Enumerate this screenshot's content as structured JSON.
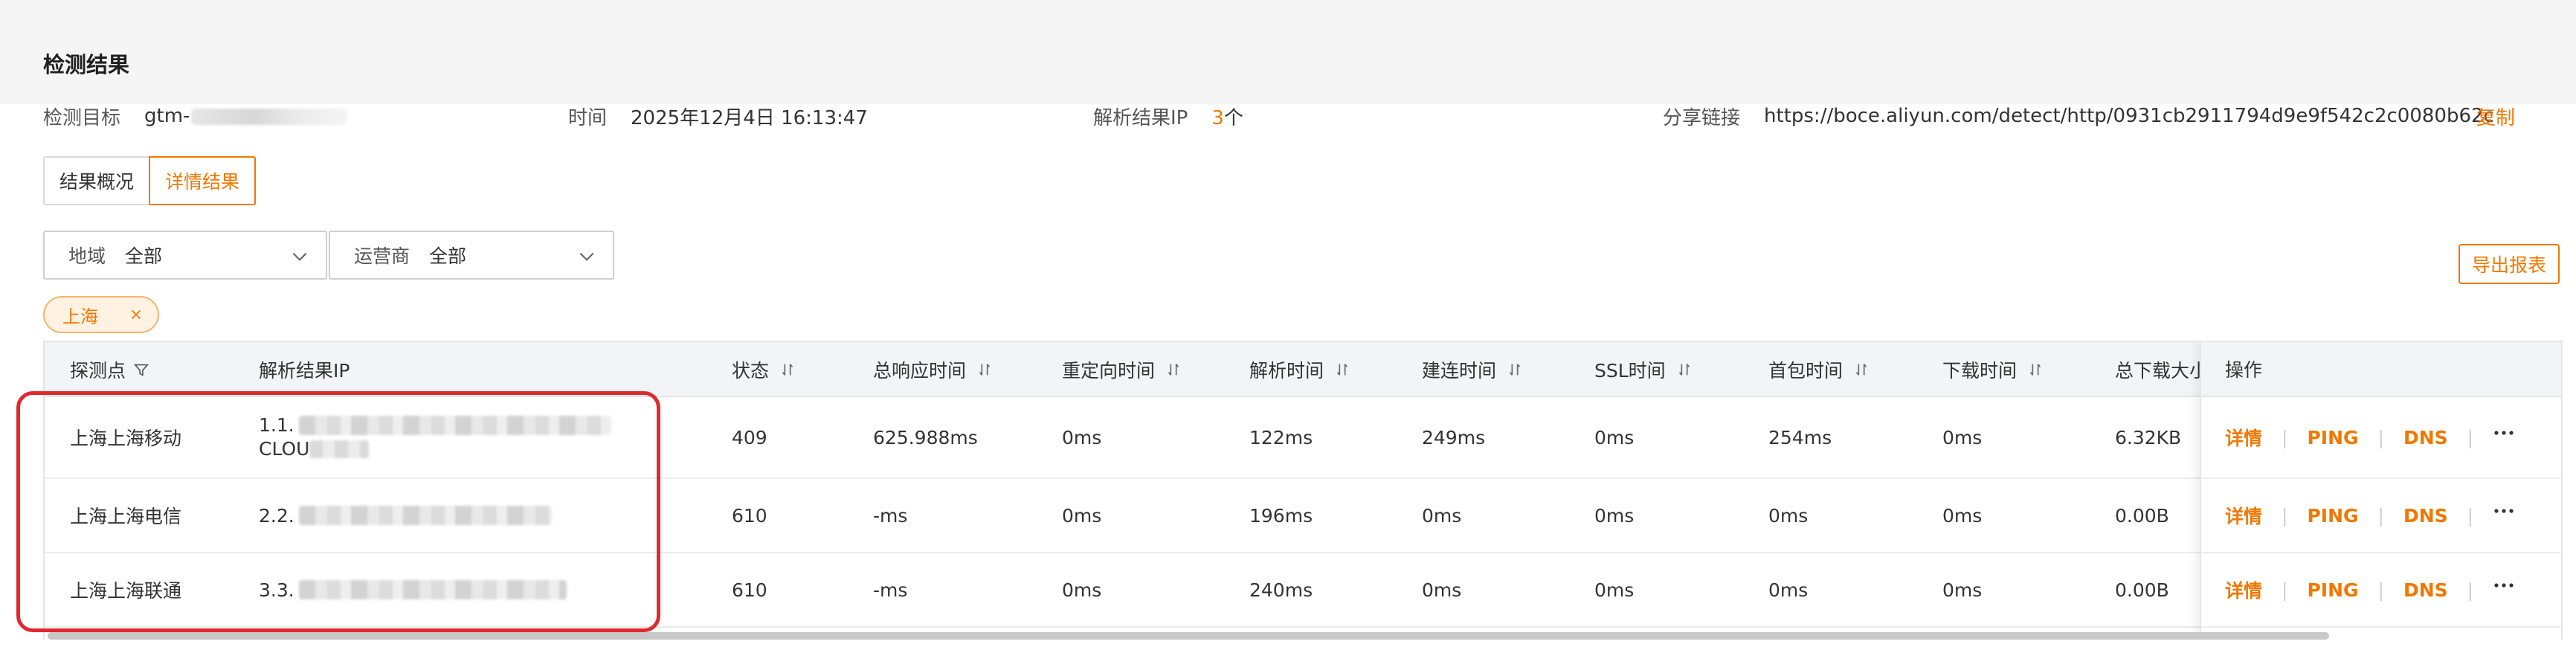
{
  "page_title": "检测结果",
  "info": {
    "target_label": "检测目标",
    "target_value": "gtm-",
    "time_label": "时间",
    "time_value": "2025年12月4日 16:13:47",
    "resolved_label": "解析结果IP",
    "resolved_count": "3",
    "resolved_unit": "个",
    "share_label": "分享链接",
    "share_value": "https://boce.aliyun.com/detect/http/0931cb2911794d9e9f542c2c0080b62c",
    "copy_label": "复制"
  },
  "tabs": [
    {
      "label": "结果概况",
      "active": false
    },
    {
      "label": "详情结果",
      "active": true
    }
  ],
  "filters": {
    "region_label": "地域",
    "region_value": "全部",
    "isp_label": "运营商",
    "isp_value": "全部"
  },
  "export_label": "导出报表",
  "active_tag": "上海",
  "table": {
    "headers": [
      "探测点",
      "解析结果IP",
      "状态",
      "总响应时间",
      "重定向时间",
      "解析时间",
      "建连时间",
      "SSL时间",
      "首包时间",
      "下载时间",
      "总下载大小",
      "操作"
    ],
    "rows": [
      {
        "probe": "上海上海移动",
        "ip": "1.1.",
        "ip_extra": "CLOU",
        "status": "409",
        "total": "625.988ms",
        "redirect": "0ms",
        "dns": "122ms",
        "connect": "249ms",
        "ssl": "0ms",
        "first_byte": "254ms",
        "download": "0ms",
        "size": "6.32KB"
      },
      {
        "probe": "上海上海电信",
        "ip": "2.2.",
        "ip_extra": "",
        "status": "610",
        "total": "-ms",
        "redirect": "0ms",
        "dns": "196ms",
        "connect": "0ms",
        "ssl": "0ms",
        "first_byte": "0ms",
        "download": "0ms",
        "size": "0.00B"
      },
      {
        "probe": "上海上海联通",
        "ip": "3.3.",
        "ip_extra": "",
        "status": "610",
        "total": "-ms",
        "redirect": "0ms",
        "dns": "240ms",
        "connect": "0ms",
        "ssl": "0ms",
        "first_byte": "0ms",
        "download": "0ms",
        "size": "0.00B"
      }
    ],
    "actions": {
      "detail": "详情",
      "ping": "PING",
      "dns": "DNS"
    }
  },
  "colors": {
    "accent": "#f07800",
    "highlight_box": "#e0292e",
    "header_bg": "#f2f4f7"
  },
  "icons": [
    "filter-icon",
    "sort-icon",
    "chevron-down-icon",
    "close-icon",
    "more-icon"
  ]
}
